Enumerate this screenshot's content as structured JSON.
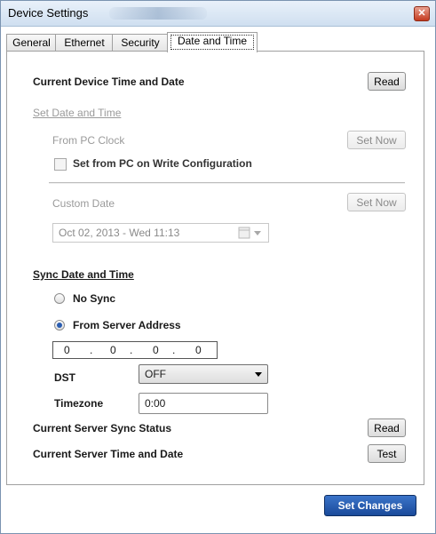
{
  "window": {
    "title": "Device Settings"
  },
  "tabs": [
    "General",
    "Ethernet",
    "Security",
    "Date and Time"
  ],
  "current_device": {
    "label": "Current Device Time and Date",
    "read_label": "Read"
  },
  "set_date": {
    "heading": "Set Date and Time",
    "from_pc_label": "From PC Clock",
    "set_now_label": "Set Now",
    "checkbox_label": "Set from PC on Write Configuration",
    "custom_date_label": "Custom Date",
    "custom_set_now_label": "Set Now",
    "date_value": "Oct  02, 2013 - Wed 11:13"
  },
  "sync": {
    "heading": "Sync Date and Time",
    "no_sync_label": "No Sync",
    "from_server_label": "From Server Address",
    "ip": [
      "0",
      "0",
      "0",
      "0"
    ],
    "dst_label": "DST",
    "dst_value": "OFF",
    "timezone_label": "Timezone",
    "timezone_value": "0:00"
  },
  "server_status": {
    "label": "Current Server Sync Status",
    "read_label": "Read"
  },
  "server_time": {
    "label": "Current Server Time and Date",
    "test_label": "Test"
  },
  "footer": {
    "set_changes_label": "Set Changes"
  }
}
